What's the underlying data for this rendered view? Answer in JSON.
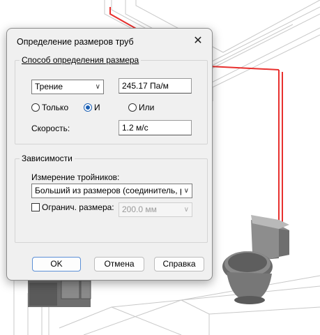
{
  "dialog": {
    "title": "Определение размеров труб",
    "close_glyph": "✕"
  },
  "sizing_method": {
    "legend": "Способ определения размера",
    "method_select": "Трение",
    "friction_value": "245.17 Па/м",
    "radio_only": "Только",
    "radio_and": "И",
    "radio_or": "Или",
    "selected_radio": "И",
    "velocity_label": "Скорость:",
    "velocity_value": "1.2 м/с"
  },
  "constraints": {
    "legend": "Зависимости",
    "tee_label": "Измерение тройников:",
    "tee_select": "Больший из размеров (соединитель, рас",
    "limit_label": "Огранич. размера:",
    "limit_checked": false,
    "limit_value": "200.0 мм"
  },
  "buttons": {
    "ok": "OK",
    "cancel": "Отмена",
    "help": "Справка"
  },
  "colors": {
    "pipe": "#e8302e",
    "accent": "#1a5fb4"
  }
}
